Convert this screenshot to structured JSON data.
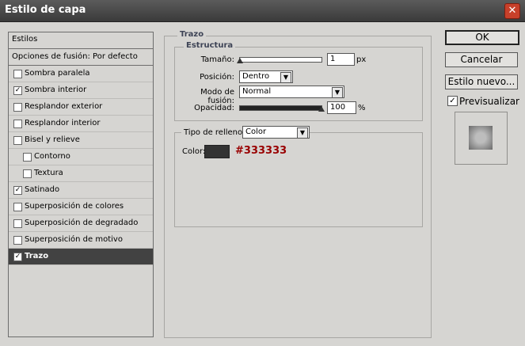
{
  "window": {
    "title": "Estilo de capa"
  },
  "styles_panel": {
    "header": "Estilos",
    "blend_options": "Opciones de fusión: Por defecto",
    "items": [
      {
        "label": "Sombra paralela",
        "checked": false,
        "indent": false,
        "selected": false
      },
      {
        "label": "Sombra interior",
        "checked": true,
        "indent": false,
        "selected": false
      },
      {
        "label": "Resplandor exterior",
        "checked": false,
        "indent": false,
        "selected": false
      },
      {
        "label": "Resplandor interior",
        "checked": false,
        "indent": false,
        "selected": false
      },
      {
        "label": "Bisel y relieve",
        "checked": false,
        "indent": false,
        "selected": false
      },
      {
        "label": "Contorno",
        "checked": false,
        "indent": true,
        "selected": false
      },
      {
        "label": "Textura",
        "checked": false,
        "indent": true,
        "selected": false
      },
      {
        "label": "Satinado",
        "checked": true,
        "indent": false,
        "selected": false
      },
      {
        "label": "Superposición de colores",
        "checked": false,
        "indent": false,
        "selected": false
      },
      {
        "label": "Superposición de degradado",
        "checked": false,
        "indent": false,
        "selected": false
      },
      {
        "label": "Superposición de motivo",
        "checked": false,
        "indent": false,
        "selected": false
      },
      {
        "label": "Trazo",
        "checked": true,
        "indent": false,
        "selected": true
      }
    ]
  },
  "stroke": {
    "title": "Trazo",
    "structure": {
      "title": "Estructura",
      "size_label": "Tamaño:",
      "size_value": "1",
      "size_unit": "px",
      "size_fraction": 0.0,
      "position_label": "Posición:",
      "position_value": "Dentro",
      "blend_mode_label": "Modo de fusión:",
      "blend_mode_value": "Normal",
      "opacity_label": "Opacidad:",
      "opacity_value": "100",
      "opacity_unit": "%",
      "opacity_fraction": 1.0
    },
    "fill": {
      "type_label": "Tipo de relleno:",
      "type_value": "Color",
      "color_label": "Color:",
      "color_hex_label": "#333333",
      "swatch_color": "#333333",
      "hex_text_color": "#990000"
    }
  },
  "buttons": {
    "ok": "OK",
    "cancel": "Cancelar",
    "new_style": "Estilo nuevo...",
    "preview_label": "Previsualizar",
    "preview_checked": true
  }
}
